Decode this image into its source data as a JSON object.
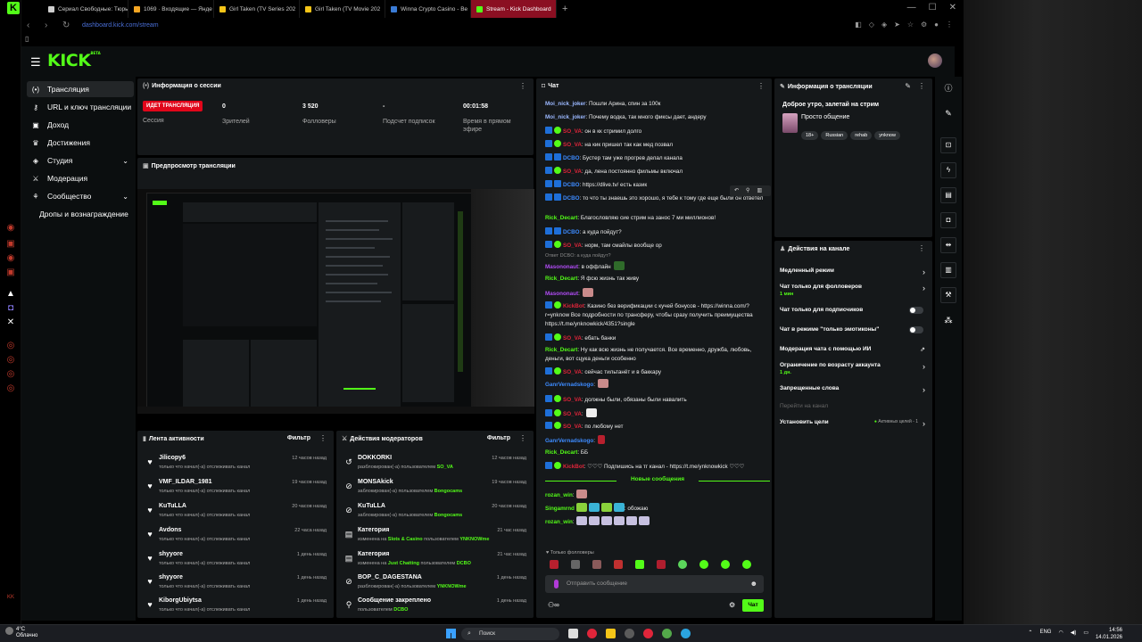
{
  "browser": {
    "kick_count": "0",
    "tabs": [
      {
        "title": "Сериал Свободные: Тюрь",
        "color": "#cfcfcf"
      },
      {
        "title": "1069 · Входящие — Янде",
        "color": "#f5a623"
      },
      {
        "title": "Girl Taken (TV Series 202",
        "color": "#f5c518"
      },
      {
        "title": "Girl Taken (TV Movie 202",
        "color": "#f5c518"
      },
      {
        "title": "Winna Crypto Casino - Be",
        "color": "#3a7bd5"
      },
      {
        "title": "Stream - Kick Dashboard",
        "color": "#53fc18"
      }
    ],
    "new_tab": "+",
    "url": "dashboard.kick.com/stream"
  },
  "header": {
    "logo": "KICK",
    "logo_beta": "BETA"
  },
  "sidebar": {
    "items": [
      {
        "label": "Трансляция",
        "icon": "broadcast-icon",
        "glyph": "(•)"
      },
      {
        "label": "URL и ключ трансляции",
        "icon": "key-icon",
        "glyph": "⚷"
      },
      {
        "label": "Доход",
        "icon": "money-icon",
        "glyph": "▣"
      },
      {
        "label": "Достижения",
        "icon": "trophy-icon",
        "glyph": "♛"
      },
      {
        "label": "Студия",
        "icon": "studio-icon",
        "glyph": "◈"
      },
      {
        "label": "Модерация",
        "icon": "sword-icon",
        "glyph": "⚔"
      },
      {
        "label": "Сообщество",
        "icon": "community-icon",
        "glyph": "⚘"
      },
      {
        "label": "Дропы и вознаграждение",
        "icon": "",
        "glyph": ""
      }
    ]
  },
  "session": {
    "title": "Информация о сессии",
    "live_badge": "ИДЕТ ТРАНСЛЯЦИЯ",
    "session_label": "Сессия",
    "stats": [
      {
        "value": "0",
        "label": "Зрителей"
      },
      {
        "value": "3 520",
        "label": "Фолловеры"
      },
      {
        "value": "-",
        "label": "Подсчет подписок"
      },
      {
        "value": "00:01:58",
        "label": "Время в прямом эфире"
      }
    ]
  },
  "preview": {
    "title": "Предпросмотр трансляции"
  },
  "activity": {
    "title": "Лента активности",
    "filter": "Фильтр",
    "rows": [
      {
        "name": "Jilicopy6",
        "sub": "только что начал(-а) отслеживать канал",
        "time": "12 часов назад"
      },
      {
        "name": "VMF_ILDAR_1981",
        "sub": "только что начал(-а) отслеживать канал",
        "time": "19 часов назад"
      },
      {
        "name": "KuTuLLA",
        "sub": "только что начал(-а) отслеживать канал",
        "time": "20 часов назад"
      },
      {
        "name": "Avdons",
        "sub": "только что начал(-а) отслеживать канал",
        "time": "22 часа назад"
      },
      {
        "name": "shyyore",
        "sub": "только что начал(-а) отслеживать канал",
        "time": "1 день назад"
      },
      {
        "name": "shyyore",
        "sub": "только что начал(-а) отслеживать канал",
        "time": "1 день назад"
      },
      {
        "name": "KiborgUbiytsa",
        "sub": "только что начал(-а) отслеживать канал",
        "time": "1 день назад"
      }
    ]
  },
  "mod_actions": {
    "title": "Действия модераторов",
    "filter": "Фильтр",
    "rows": [
      {
        "name": "DOKKORKI",
        "sub": "разблокирован(-а) пользователем",
        "by": "SO_VA",
        "time": "12 часов назад",
        "icon": "undo-icon",
        "glyph": "↺"
      },
      {
        "name": "MONSAkick",
        "sub": "заблокирован(-а) пользователем",
        "by": "Bongocams",
        "time": "19 часов назад",
        "icon": "ban-icon",
        "glyph": "⊘"
      },
      {
        "name": "KuTuLLA",
        "sub": "заблокирован(-а) пользователем",
        "by": "Bongocams",
        "time": "20 часов назад",
        "icon": "ban-icon",
        "glyph": "⊘"
      },
      {
        "name": "Категория",
        "sub": "изменена на",
        "cat": "Slots & Casino",
        "sub2": "пользователем",
        "by": "YNKNOWme",
        "time": "21 час назад",
        "icon": "category-icon",
        "glyph": "▤"
      },
      {
        "name": "Категория",
        "sub": "изменена на",
        "cat": "Just Chatting",
        "sub2": "пользователем",
        "by": "DCBO",
        "time": "21 час назад",
        "icon": "category-icon",
        "glyph": "▤"
      },
      {
        "name": "BOP_C_DAGESTANA",
        "sub": "разблокирован(-а) пользователем",
        "by": "YNKNOWme",
        "time": "1 день назад",
        "icon": "ban-icon",
        "glyph": "⊘"
      },
      {
        "name": "Сообщение закреплено",
        "sub": "пользователем",
        "by": "DCBO",
        "time": "1 день назад",
        "icon": "pin-icon",
        "glyph": "⚲"
      }
    ]
  },
  "chat": {
    "title": "Чат",
    "messages": [
      {
        "user": "Moi_nick_joker",
        "color": "#9bb8ff",
        "badge": "",
        "text": ": Пошли Арина, спин за 100к"
      },
      {
        "user": "Moi_nick_joker",
        "color": "#9bb8ff",
        "badge": "",
        "text": ": Почему водка, так много фиксы дает, андеру"
      },
      {
        "user": "SO_VA",
        "color": "#e0253a",
        "badge": "mod",
        "text": ": он в кк стримил долго"
      },
      {
        "user": "SO_VA",
        "color": "#e0253a",
        "badge": "mod",
        "text": ": на кик пришел так как мед позвал"
      },
      {
        "user": "DCBO",
        "color": "#3d8bff",
        "badge": "mod2",
        "text": ": Бустер там уже прогрев делал канала"
      },
      {
        "user": "SO_VA",
        "color": "#e0253a",
        "badge": "mod",
        "text": ": да, лена постоянно фильмы включал"
      },
      {
        "user": "DCBO",
        "color": "#3d8bff",
        "badge": "mod2",
        "text": ": https://dlive.tv/ есть казик"
      },
      {
        "user": "DCBO",
        "color": "#3d8bff",
        "badge": "mod2",
        "text": ": то что ты знаешь это хорошо, я тебе к тому где еще были он ответел"
      },
      {
        "user": "Rick_Decart",
        "color": "#53fc18",
        "badge": "",
        "text": ": Благословляю сие стрим на занос 7 ми миллионов!"
      },
      {
        "user": "DCBO",
        "color": "#3d8bff",
        "badge": "mod2",
        "text": ": а куда пойдут?"
      },
      {
        "user": "SO_VA",
        "color": "#e0253a",
        "badge": "mod",
        "text": ": норм, там смайлы вообще ор"
      },
      {
        "user": "Masononaut",
        "color": "#b14cf5",
        "badge": "",
        "text": ": в оффлайн",
        "reply": "Ответ DCBO: а куда пойдут?"
      },
      {
        "user": "Rick_Decart",
        "color": "#53fc18",
        "badge": "",
        "text": ": Я фсю жизнь так живу"
      },
      {
        "user": "Masononaut",
        "color": "#b14cf5",
        "badge": "",
        "text": ":"
      },
      {
        "user": "KickBot",
        "color": "#e0253a",
        "badge": "bot",
        "text": ": Казино без верификации с кучей бонусов - https://winna.com/?r=ynknow Все подробности по трансферу, чтобы сразу получить преимущества https://t.me/ynknowkick/4351?single"
      },
      {
        "user": "SO_VA",
        "color": "#e0253a",
        "badge": "mod",
        "text": ": ебать банки"
      },
      {
        "user": "Rick_Decart",
        "color": "#53fc18",
        "badge": "",
        "text": ": Ну как всю жизнь не получается. Все временно, дружба, любовь, деньги, вот сцука деньги особенно"
      },
      {
        "user": "SO_VA",
        "color": "#e0253a",
        "badge": "mod",
        "text": ": сейчас тильтанёт и в баккару"
      },
      {
        "user": "GanrVernadskogo",
        "color": "#3d8bff",
        "badge": "",
        "text": ":"
      },
      {
        "user": "SO_VA",
        "color": "#e0253a",
        "badge": "mod",
        "text": ": должны были, обязаны были навалить"
      },
      {
        "user": "SO_VA",
        "color": "#e0253a",
        "badge": "mod",
        "text": ":"
      },
      {
        "user": "SO_VA",
        "color": "#e0253a",
        "badge": "mod",
        "text": ": по любому нет"
      },
      {
        "user": "GanrVernadskogo",
        "color": "#3d8bff",
        "badge": "",
        "text": ":"
      },
      {
        "user": "Rick_Decart",
        "color": "#53fc18",
        "badge": "",
        "text": ": ББ"
      },
      {
        "user": "KickBot",
        "color": "#e0253a",
        "badge": "bot",
        "text": ": ♡♡♡ Подпишись на тг канал - https://t.me/ynknowkick ♡♡♡"
      }
    ],
    "new_messages": "Новые сообщения",
    "new": [
      {
        "user": "rozan_win",
        "color": "#53fc18",
        "text": ":"
      },
      {
        "user": "Singamrnd",
        "color": "#53fc18",
        "text": ": обожаю"
      },
      {
        "user": "rozan_win",
        "color": "#53fc18",
        "text": ":"
      }
    ],
    "followers_only": "Только фолловеры",
    "input_placeholder": "Отправить сообщение",
    "send_label": "Чат"
  },
  "stream_info": {
    "title": "Информация о трансляции",
    "stream_title": "Доброе утро, залетай на стрим",
    "category": "Просто общение",
    "tags": [
      "18+",
      "Russian",
      "rehab",
      "ynknow"
    ]
  },
  "channel_actions": {
    "title": "Действия на канале",
    "rows": [
      {
        "label": "Медленный режим",
        "sub": "",
        "kind": "chevron"
      },
      {
        "label": "Чат только для фолловеров",
        "sub": "1 мин",
        "kind": "chevron"
      },
      {
        "label": "Чат только для подписчиков",
        "sub": "",
        "kind": "toggle"
      },
      {
        "label": "Чат в режиме \"только эмотиконы\"",
        "sub": "",
        "kind": "toggle"
      },
      {
        "label": "Модерация чата с помощью ИИ",
        "sub": "",
        "kind": "external"
      },
      {
        "label": "Ограничение по возрасту аккаунта",
        "sub": "1 дн.",
        "kind": "chevron"
      },
      {
        "label": "Запрещенные слова",
        "sub": "",
        "kind": "chevron"
      },
      {
        "label": "Перейти на канал",
        "sub": "",
        "kind": "muted"
      },
      {
        "label": "Установить цели",
        "sub": "",
        "kind": "goals",
        "note": "Активных целей - 1"
      }
    ]
  },
  "taskbar": {
    "temp": "4°C",
    "weather": "Облачно",
    "search": "Поиск",
    "lang": "ENG",
    "time": "14:56",
    "date": "14.01.2026"
  },
  "colors": {
    "accent": "#53fc18",
    "live": "#e1061a",
    "panel": "#15181a"
  }
}
